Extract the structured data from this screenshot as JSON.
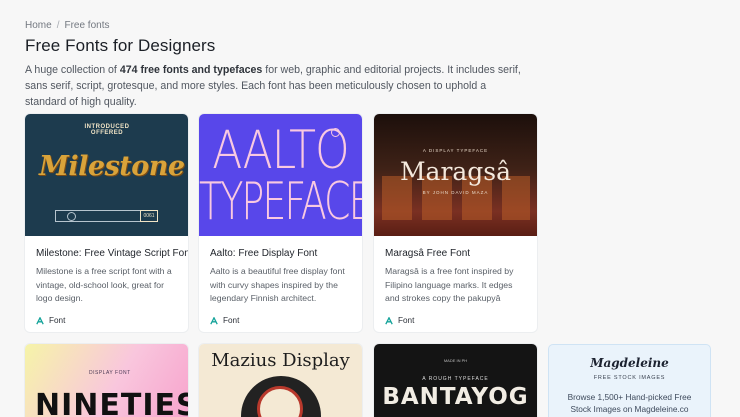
{
  "breadcrumb": {
    "home": "Home",
    "separator": "/",
    "current": "Free fonts"
  },
  "page": {
    "title": "Free Fonts for Designers",
    "intro_prefix": "A huge collection of ",
    "intro_bold": "474 free fonts and typefaces",
    "intro_suffix": " for web, graphic and editorial projects. It includes serif, sans serif, script, grotesque, and more styles. Each font has been meticulously chosen to uphold a standard of high quality."
  },
  "cards": [
    {
      "title": "Milestone: Free Vintage Script Font",
      "description": "Milestone is a free script font with a vintage, old-school look, great for logo design.",
      "tag": "Font",
      "thumb": {
        "top_text": "INTRODUCED OFFERED",
        "main": "Milestone",
        "badge": "0061"
      }
    },
    {
      "title": "Aalto: Free Display Font",
      "description": "Aalto is a beautiful free display font with curvy shapes inspired by the legendary Finnish architect.",
      "tag": "Font",
      "thumb": {
        "line1": "AALTO",
        "line2": "TYPEFACE"
      }
    },
    {
      "title": "Maragsâ Free Font",
      "description": "Maragsâ is a free font inspired by Filipino language marks. It edges and strokes copy the pakupyâ accent, whic…",
      "tag": "Font",
      "thumb": {
        "top_text": "A DISPLAY TYPEFACE",
        "main": "Maragsâ",
        "sub_text": "BY JOHN DAVID MAZA"
      }
    }
  ],
  "row2": [
    {
      "thumb": {
        "small": "DISPLAY FONT",
        "main": "NINETIES"
      }
    },
    {
      "thumb": {
        "main": "Mazius Display"
      }
    },
    {
      "thumb": {
        "small_top": "MADE IN PH",
        "small": "A ROUGH TYPEFACE",
        "main": "BANTAYOG"
      }
    }
  ],
  "promo": {
    "logo": "Magdeleine",
    "subtitle": "FREE STOCK IMAGES",
    "text": "Browse 1,500+ Hand-picked Free Stock Images on Magdeleine.co"
  },
  "colors": {
    "background": "#f7f7f7",
    "tag_icon": "#14a39a"
  },
  "icons": {
    "tag": "font-a-icon"
  }
}
